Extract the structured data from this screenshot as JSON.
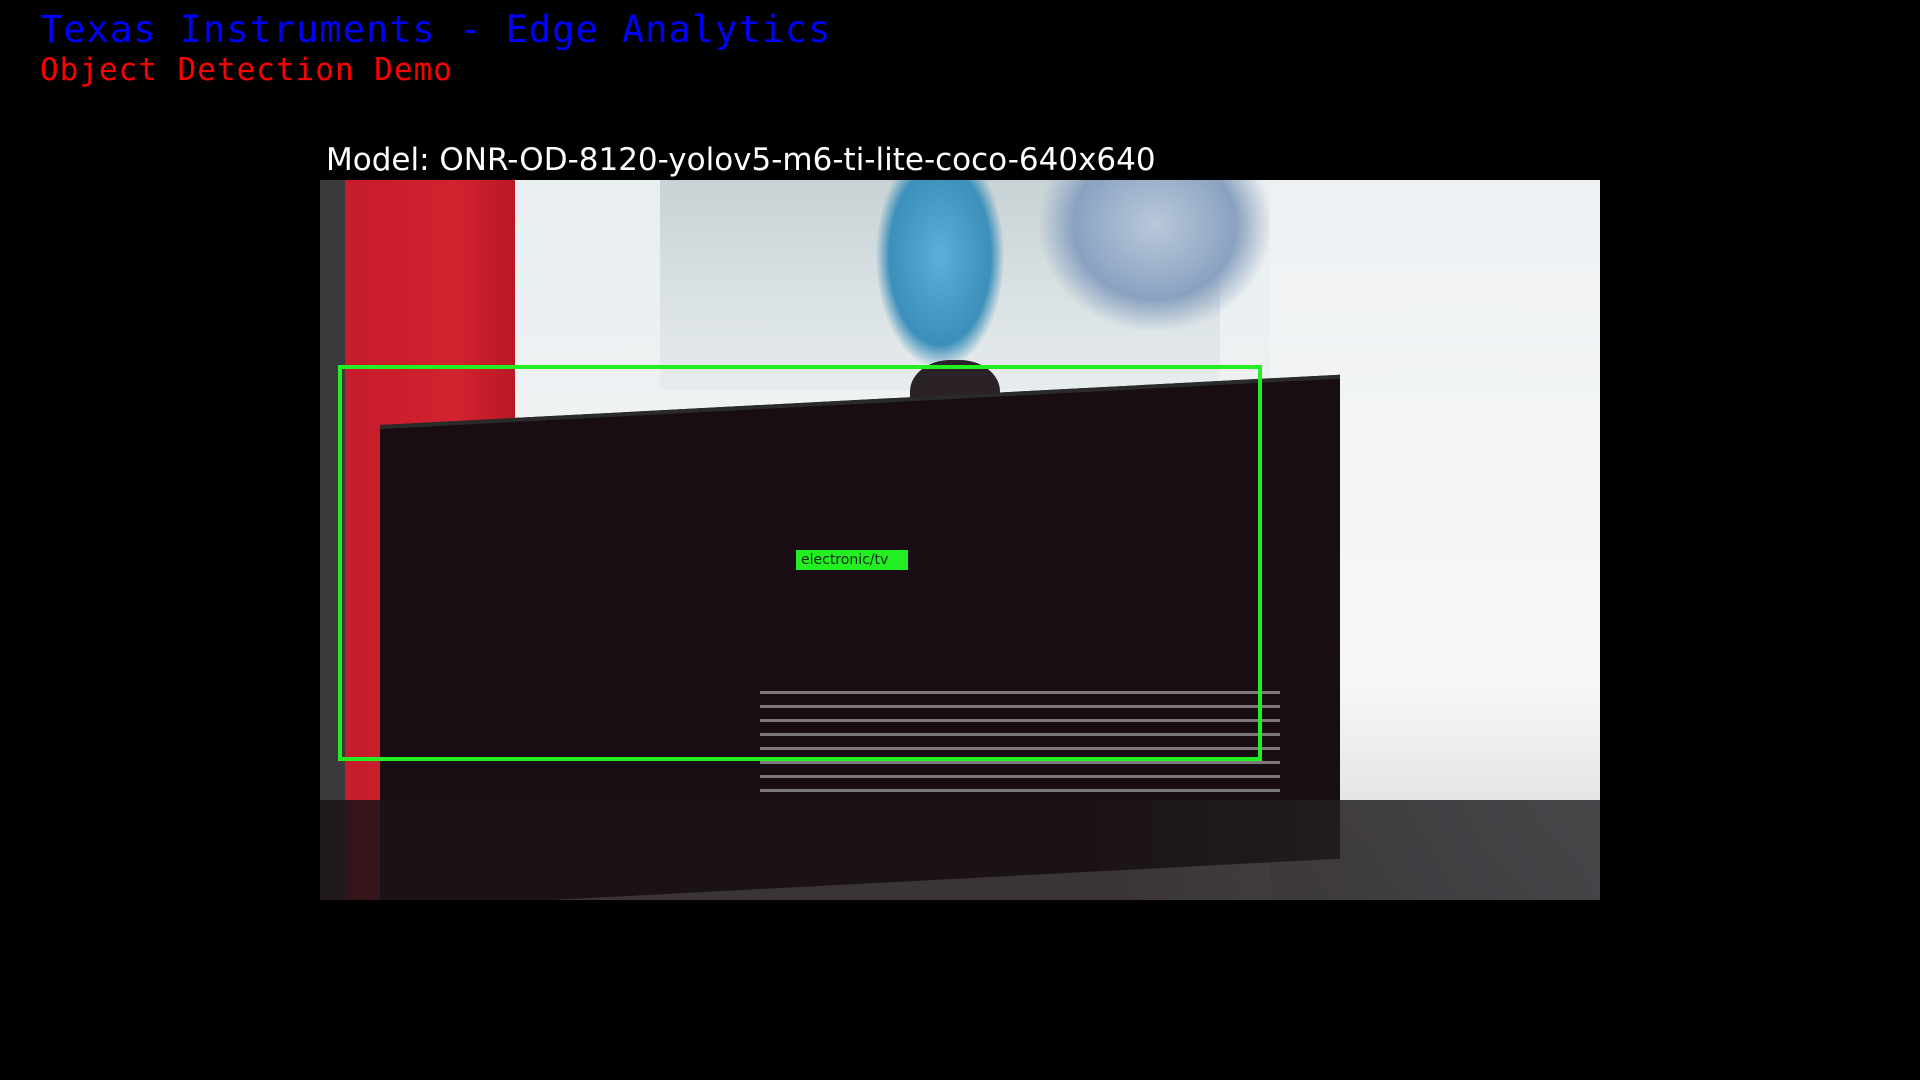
{
  "header": {
    "title": "Texas Instruments - Edge Analytics",
    "subtitle": "Object Detection Demo"
  },
  "model": {
    "label": "Model: ONR-OD-8120-yolov5-m6-ti-lite-coco-640x640"
  },
  "detections": [
    {
      "label": "electronic/tv",
      "color": "#22ee22"
    }
  ],
  "colors": {
    "title": "#0000ff",
    "subtitle": "#ff0000",
    "model_label": "#ffffff",
    "background": "#000000"
  }
}
